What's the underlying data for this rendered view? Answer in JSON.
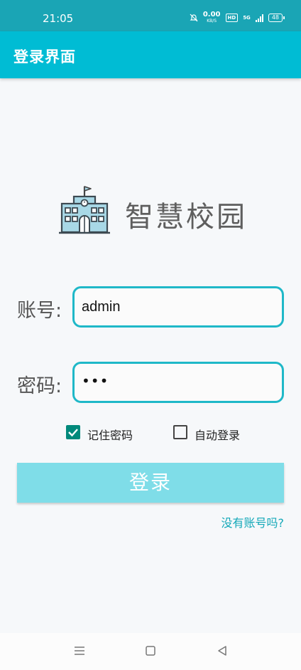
{
  "status_bar": {
    "time": "21:05",
    "net_speed_value": "0.00",
    "net_speed_unit": "KB/S",
    "hd": "HD",
    "network": "5G",
    "battery": "48"
  },
  "app_bar": {
    "title": "登录界面"
  },
  "brand": {
    "name": "智慧校园",
    "icon": "school-building-icon"
  },
  "account": {
    "label": "账号:",
    "value": "admin"
  },
  "password": {
    "label": "密码:",
    "value": "•••"
  },
  "options": {
    "remember_password": {
      "label": "记住密码",
      "checked": true
    },
    "auto_login": {
      "label": "自动登录",
      "checked": false
    }
  },
  "login_button": {
    "label": "登录"
  },
  "register_link": {
    "label": "没有账号吗?"
  },
  "nav": {
    "menu_icon": "menu-icon",
    "home_icon": "home-square-icon",
    "back_icon": "back-triangle-icon"
  },
  "colors": {
    "status_bar": "#1aa5b5",
    "app_bar": "#00bcd4",
    "accent": "#1fb8c8",
    "checkbox": "#00897b",
    "button": "#7fdde8"
  }
}
